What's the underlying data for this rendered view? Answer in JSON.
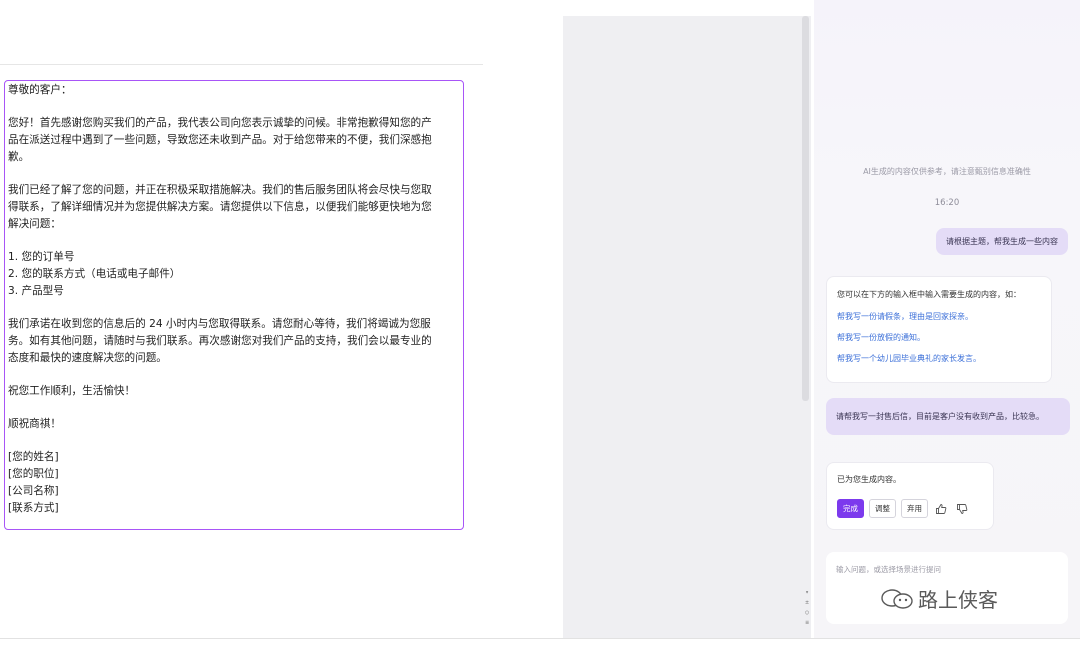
{
  "document": {
    "lines": [
      "尊敬的客户：",
      "",
      "您好！首先感谢您购买我们的产品，我代表公司向您表示诚挚的问候。非常抱歉得知您的产",
      "品在派送过程中遇到了一些问题，导致您还未收到产品。对于给您带来的不便，我们深感抱",
      "歉。",
      "",
      "我们已经了解了您的问题，并正在积极采取措施解决。我们的售后服务团队将会尽快与您取",
      "得联系，了解详细情况并为您提供解决方案。请您提供以下信息，以便我们能够更快地为您",
      "解决问题：",
      "",
      "1. 您的订单号",
      "2. 您的联系方式（电话或电子邮件）",
      "3. 产品型号",
      "",
      "我们承诺在收到您的信息后的 24 小时内与您取得联系。请您耐心等待，我们将竭诚为您服",
      "务。如有其他问题，请随时与我们联系。再次感谢您对我们产品的支持，我们会以最专业的",
      "态度和最快的速度解决您的问题。",
      "",
      "祝您工作顺利，生活愉快！",
      "",
      "顺祝商祺！",
      "",
      "[您的姓名]",
      "[您的职位]",
      "[公司名称]",
      "[联系方式]"
    ]
  },
  "mini_nav": [
    "▾",
    "±",
    "○",
    "≡"
  ],
  "assistant": {
    "disclaimer": "AI生成的内容仅供参考，请注意甄别信息准确性",
    "time": "16:20",
    "user_msg_1": "请根据主题，帮我生成一些内容",
    "ai_msg_1": {
      "intro": "您可以在下方的输入框中输入需要生成的内容，如：",
      "examples": [
        "帮我写一份请假条，理由是回家探亲。",
        "帮我写一份放假的通知。",
        "帮我写一个幼儿园毕业典礼的家长发言。"
      ]
    },
    "user_msg_2": "请帮我写一封售后信，目前是客户没有收到产品，比较急。",
    "ai_msg_2": {
      "text": "已为您生成内容。",
      "done_label": "完成",
      "adjust_label": "调整",
      "discard_label": "弃用"
    },
    "input_placeholder": "输入问题，或选择场景进行提问"
  },
  "watermark": "路上侠客",
  "colors": {
    "accent": "#7c3aed",
    "selection_border": "#a855f7",
    "link": "#3b6fd8",
    "user_bubble": "#e4dcf7"
  }
}
